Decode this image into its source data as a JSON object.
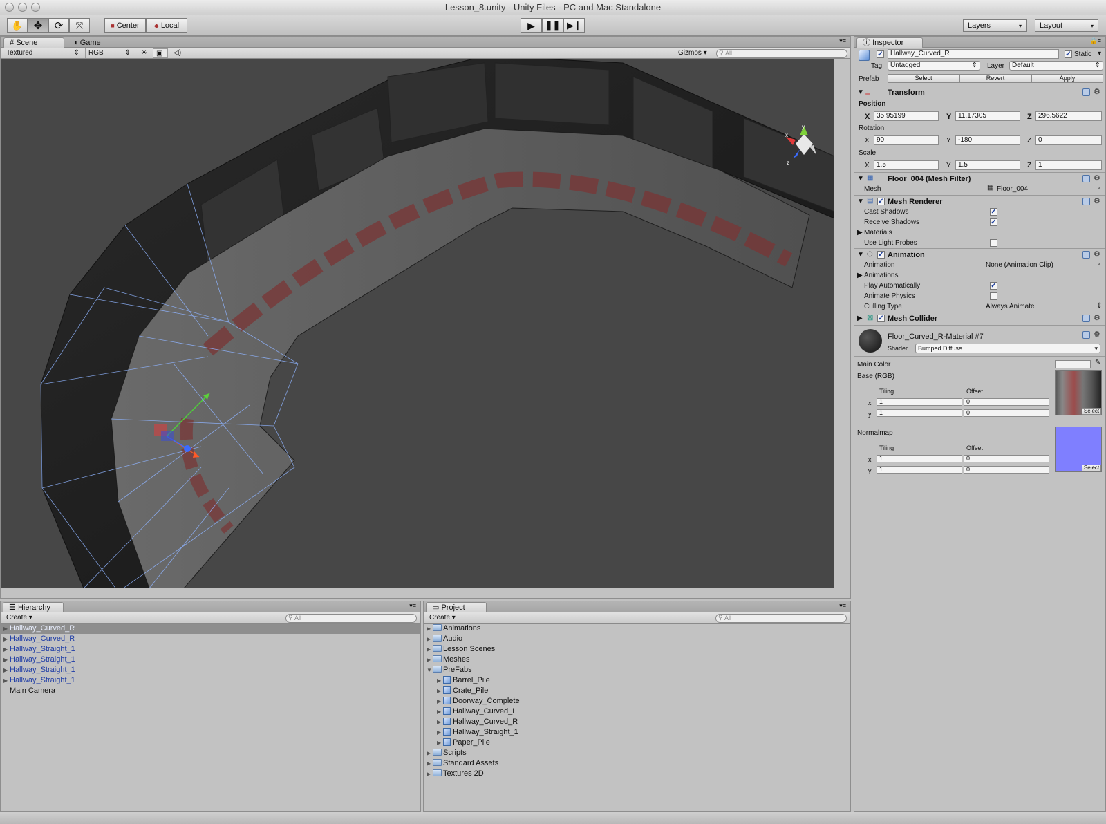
{
  "window": {
    "title": "Lesson_8.unity - Unity Files - PC and Mac Standalone"
  },
  "toolbar": {
    "tools": [
      "hand-tool",
      "move-tool",
      "rotate-tool",
      "scale-tool"
    ],
    "pivot": "Center",
    "space": "Local",
    "layers": "Layers",
    "layout": "Layout"
  },
  "scene": {
    "tab_scene": "Scene",
    "tab_game": "Game",
    "render_mode": "Textured",
    "color_mode": "RGB",
    "gizmos": "Gizmos",
    "search_placeholder": "All",
    "axis_labels": {
      "x": "x",
      "y": "y",
      "z": "z"
    }
  },
  "hierarchy": {
    "tab": "Hierarchy",
    "create": "Create",
    "search_placeholder": "All",
    "items": [
      {
        "label": "Hallway_Curved_R",
        "prefab": true,
        "selected": true
      },
      {
        "label": "Hallway_Curved_R",
        "prefab": true
      },
      {
        "label": "Hallway_Straight_1",
        "prefab": true
      },
      {
        "label": "Hallway_Straight_1",
        "prefab": true
      },
      {
        "label": "Hallway_Straight_1",
        "prefab": true
      },
      {
        "label": "Hallway_Straight_1",
        "prefab": true
      },
      {
        "label": "Main Camera",
        "prefab": false
      }
    ]
  },
  "project": {
    "tab": "Project",
    "create": "Create",
    "search_placeholder": "All",
    "folders_top": [
      "Animations",
      "Audio",
      "Lesson Scenes",
      "Meshes"
    ],
    "prefabs_folder": "PreFabs",
    "prefabs": [
      "Barrel_Pile",
      "Crate_Pile",
      "Doorway_Complete",
      "Hallway_Curved_L",
      "Hallway_Curved_R",
      "Hallway_Straight_1",
      "Paper_Pile"
    ],
    "folders_bottom": [
      "Scripts",
      "Standard Assets",
      "Textures 2D"
    ]
  },
  "inspector": {
    "tab": "Inspector",
    "object_name": "Hallway_Curved_R",
    "static_label": "Static",
    "tag_label": "Tag",
    "tag_value": "Untagged",
    "layer_label": "Layer",
    "layer_value": "Default",
    "prefab_label": "Prefab",
    "prefab_buttons": [
      "Select",
      "Revert",
      "Apply"
    ],
    "transform": {
      "title": "Transform",
      "position_label": "Position",
      "rotation_label": "Rotation",
      "scale_label": "Scale",
      "position": {
        "x": "35.95199",
        "y": "11.17305",
        "z": "296.5622"
      },
      "rotation": {
        "x": "90",
        "y": "-180",
        "z": "0"
      },
      "scale": {
        "x": "1.5",
        "y": "1.5",
        "z": "1"
      }
    },
    "mesh_filter": {
      "title": "Floor_004 (Mesh Filter)",
      "mesh_label": "Mesh",
      "mesh_value": "Floor_004"
    },
    "mesh_renderer": {
      "title": "Mesh Renderer",
      "cast_shadows": "Cast Shadows",
      "receive_shadows": "Receive Shadows",
      "materials": "Materials",
      "use_light_probes": "Use Light Probes"
    },
    "animation": {
      "title": "Animation",
      "animation_label": "Animation",
      "animation_value": "None (Animation Clip)",
      "animations_label": "Animations",
      "play_auto": "Play Automatically",
      "animate_physics": "Animate Physics",
      "culling_label": "Culling Type",
      "culling_value": "Always Animate"
    },
    "mesh_collider": {
      "title": "Mesh Collider"
    },
    "material": {
      "name": "Floor_Curved_R-Material #7",
      "shader_label": "Shader",
      "shader_value": "Bumped Diffuse",
      "main_color": "Main Color",
      "base": "Base (RGB)",
      "tiling": "Tiling",
      "offset": "Offset",
      "base_tiling": {
        "x": "1",
        "y": "1"
      },
      "base_offset": {
        "x": "0",
        "y": "0"
      },
      "normalmap": "Normalmap",
      "normal_tiling": {
        "x": "1",
        "y": "1"
      },
      "normal_offset": {
        "x": "0",
        "y": "0"
      },
      "select": "Select",
      "x": "x",
      "y": "y"
    }
  },
  "xyz": {
    "x": "X",
    "y": "Y",
    "z": "Z"
  }
}
